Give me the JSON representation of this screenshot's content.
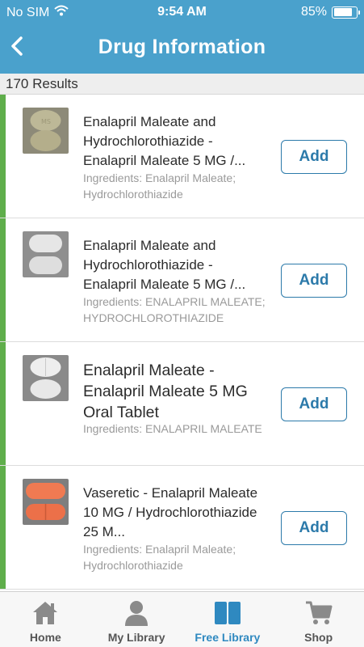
{
  "status_bar": {
    "carrier": "No SIM",
    "time": "9:54 AM",
    "battery": "85%",
    "battery_level": 0.85
  },
  "header": {
    "title": "Drug Information",
    "back_icon": "chevron-left-icon"
  },
  "results": {
    "count_label": "170 Results"
  },
  "items": [
    {
      "title": "Enalapril Maleate and Hydrochlorothiazide - Enalapril Maleate 5 MG /...",
      "ingredients": "Ingredients: Enalapril Maleate; Hydrochlorothiazide",
      "add_label": "Add",
      "thumb_color": "#b9b391"
    },
    {
      "title": "Enalapril Maleate and Hydrochlorothiazide - Enalapril Maleate 5 MG /...",
      "ingredients": "Ingredients: ENALAPRIL MALEATE; HYDROCHLOROTHIAZIDE",
      "add_label": "Add",
      "thumb_color": "#d9d9d9"
    },
    {
      "title": "Enalapril Maleate - Enalapril Maleate 5 MG Oral Tablet",
      "ingredients": "Ingredients: ENALAPRIL MALEATE",
      "add_label": "Add",
      "thumb_color": "#e2e2e2"
    },
    {
      "title": "Vaseretic - Enalapril Maleate 10 MG / Hydrochlorothiazide 25 M...",
      "ingredients": "Ingredients: Enalapril Maleate; Hydrochlorothiazide",
      "add_label": "Add",
      "thumb_color": "#f07a52"
    }
  ],
  "tabbar": {
    "tabs": [
      {
        "label": "Home",
        "icon": "home-icon",
        "active": false
      },
      {
        "label": "My Library",
        "icon": "person-icon",
        "active": false
      },
      {
        "label": "Free Library",
        "icon": "book-icon",
        "active": true
      },
      {
        "label": "Shop",
        "icon": "cart-icon",
        "active": false
      }
    ]
  },
  "colors": {
    "header": "#4aa1cc",
    "accent": "#5fae4b",
    "button": "#2c7aaa",
    "active_tab": "#2f89c0"
  }
}
